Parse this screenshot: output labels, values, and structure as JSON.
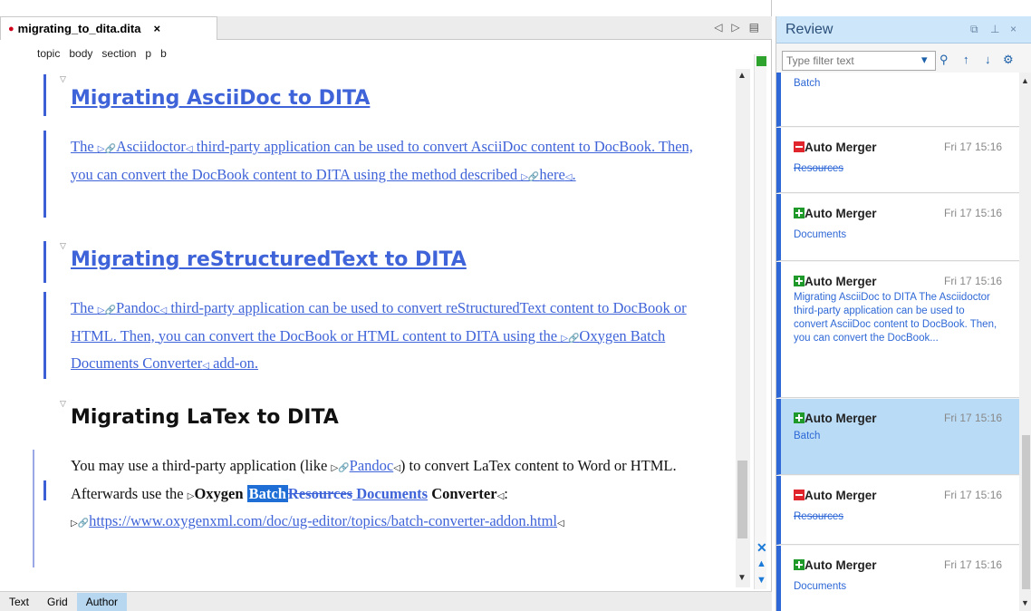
{
  "editor": {
    "tab": {
      "filename": "migrating_to_dita.dita",
      "close": "×"
    },
    "tab_nav": {
      "prev": "◁",
      "next": "▷",
      "menu": "▤"
    },
    "breadcrumb": [
      "topic",
      "body",
      "section",
      "p",
      "b"
    ],
    "sections": {
      "asciidoc": {
        "heading": "Migrating AsciiDoc to DITA",
        "p_pre": "The ",
        "link1": "Asciidoctor",
        "p_mid": " third-party application can be used to convert AsciiDoc content to DocBook. Then, you can convert the DocBook content to DITA using the method described ",
        "link2": "here",
        "p_end": "."
      },
      "rst": {
        "heading": "Migrating reStructuredText to DITA",
        "p_pre": "The ",
        "link1": "Pandoc",
        "p_mid": " third-party application can be used to convert reStructuredText content to DocBook or HTML. Then, you can convert the DocBook or HTML content to DITA using the ",
        "link2": "Oxygen Batch Documents Converter",
        "p_end": " add-on."
      },
      "latex": {
        "heading": "Migrating LaTex to DITA",
        "p_pre": "You may use a third-party application (like ",
        "link1": "Pandoc",
        "p_mid": ") to convert LaTex content to Word or HTML. Afterwards use the ",
        "oxygen": "Oxygen ",
        "batch": "Batch",
        "resources": "Resources",
        "documents": " Documents",
        "converter": " Converter",
        "sep": ": ",
        "url": "https://www.oxygenxml.com/doc/ug-editor/topics/batch-converter-addon.html"
      }
    },
    "modes": [
      "Text",
      "Grid",
      "Author"
    ],
    "active_mode": "Author"
  },
  "review": {
    "title": "Review",
    "controls": {
      "restore": "⧉",
      "pin": "⊥",
      "close": "×"
    },
    "filter_placeholder": "Type filter text",
    "tools": {
      "dropdown": "▾",
      "search": "🔍",
      "up": "↑",
      "down": "↓",
      "settings": "⚙"
    },
    "top_snippet": "Batch",
    "changes": [
      {
        "kind": "deletion",
        "author": "Auto Merger",
        "time": "Fri 17 15:16",
        "text": "Resources"
      },
      {
        "kind": "insertion",
        "author": "Auto Merger",
        "time": "Fri 17 15:16",
        "text": "Documents"
      },
      {
        "kind": "insertion",
        "author": "Auto Merger",
        "time": "Fri 17 15:16",
        "text": "Migrating AsciiDoc to DITA The Asciidoctor third-party application can be used to convert AsciiDoc content to DocBook. Then, you can convert the DocBook..."
      },
      {
        "kind": "insertion",
        "author": "Auto Merger",
        "time": "Fri 17 15:16",
        "text": "Batch"
      },
      {
        "kind": "deletion",
        "author": "Auto Merger",
        "time": "Fri 17 15:16",
        "text": "Resources"
      },
      {
        "kind": "insertion",
        "author": "Auto Merger",
        "time": "Fri 17 15:16",
        "text": "Documents"
      }
    ]
  },
  "colors": {
    "tracked_insert": "#3f63d8",
    "selection": "#1e6ed6",
    "change_bar": "#2e68d6",
    "deletion_icon": "#e0262c",
    "insertion_icon": "#1f9a2a",
    "review_header": "#cde6f9"
  }
}
